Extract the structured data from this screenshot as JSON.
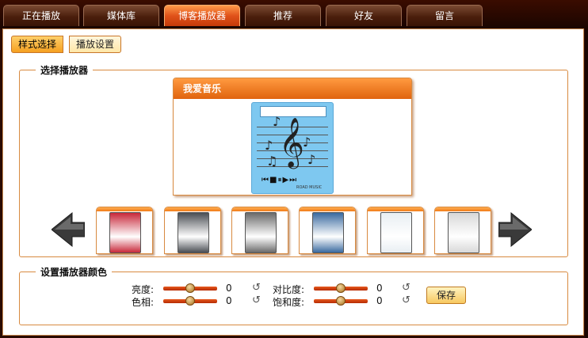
{
  "tabs": [
    {
      "label": "正在播放",
      "active": false
    },
    {
      "label": "媒体库",
      "active": false
    },
    {
      "label": "博客播放器",
      "active": true
    },
    {
      "label": "推荐",
      "active": false
    },
    {
      "label": "好友",
      "active": false
    },
    {
      "label": "留言",
      "active": false
    }
  ],
  "subtabs": {
    "style_select": "样式选择",
    "player_settings": "播放设置"
  },
  "select_player": {
    "legend": "选择播放器",
    "preview_title": "我爱音乐",
    "player_footer": "ROAD MUSIC"
  },
  "carousel": {
    "prev_icon": "left-arrow-icon",
    "next_icon": "right-arrow-icon",
    "skins": [
      {
        "name": "red-skin",
        "color": "#c8283a"
      },
      {
        "name": "dark-skin",
        "color": "#4a4e54"
      },
      {
        "name": "gray-skin",
        "color": "#6a6a6a"
      },
      {
        "name": "blue-skin",
        "color": "#3a6aa0"
      },
      {
        "name": "white-skin",
        "color": "#e8eef2"
      },
      {
        "name": "silver-skin",
        "color": "#d8d8d8"
      }
    ]
  },
  "color_settings": {
    "legend": "设置播放器颜色",
    "brightness": {
      "label": "亮度:",
      "value": "0"
    },
    "hue": {
      "label": "色相:",
      "value": "0"
    },
    "contrast": {
      "label": "对比度:",
      "value": "0"
    },
    "saturation": {
      "label": "饱和度:",
      "value": "0"
    },
    "save": "保存"
  },
  "colors": {
    "accent": "#e0641a",
    "border": "#d88a40",
    "frame": "#2a0a00"
  }
}
